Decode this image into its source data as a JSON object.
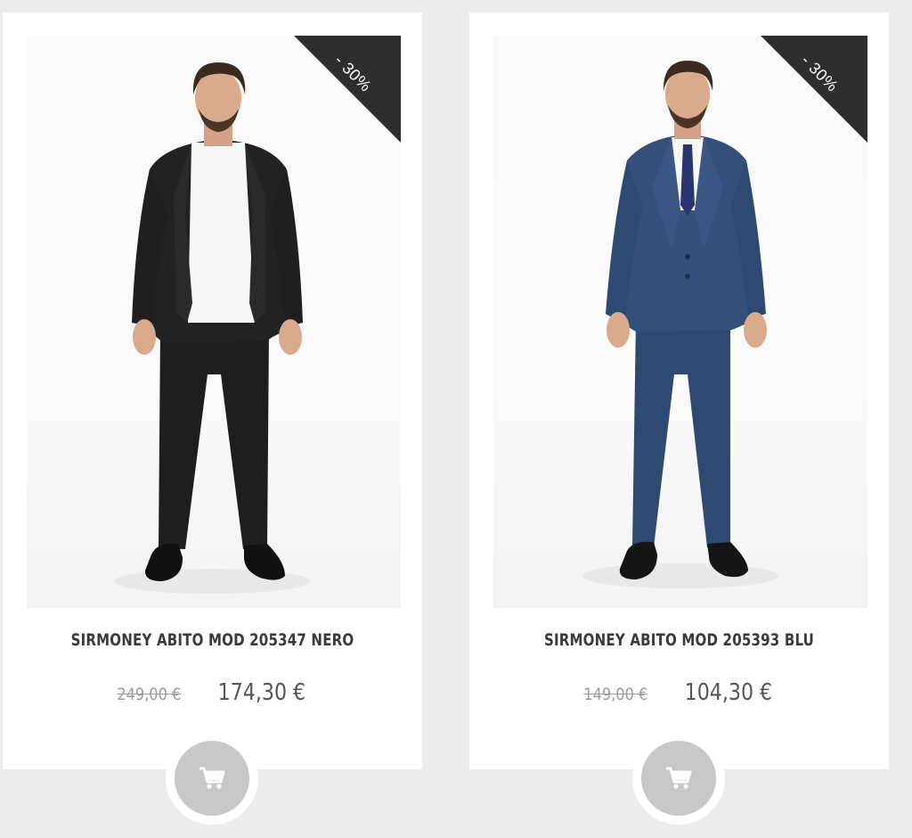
{
  "products": [
    {
      "name": "SIRMONEY ABITO MOD 205347 NERO",
      "old_price": "249,00 €",
      "price": "174,30 €",
      "discount": "- 30%",
      "suit_color": "black",
      "photo_alt": "suit-photo",
      "cart_icon": "shopping-cart-icon"
    },
    {
      "name": "SIRMONEY ABITO MOD 205393 BLU",
      "old_price": "149,00 €",
      "price": "104,30 €",
      "discount": "- 30%",
      "suit_color": "navy blue",
      "photo_alt": "suit-photo",
      "cart_icon": "shopping-cart-icon"
    }
  ],
  "colors": {
    "page_bg": "#ececec",
    "card_bg": "#ffffff",
    "ribbon": "#2e2e2e",
    "cart_button": "#c7c7c7",
    "title_text": "#3a3a3a",
    "old_price": "#9c9c9c",
    "new_price": "#555555"
  }
}
